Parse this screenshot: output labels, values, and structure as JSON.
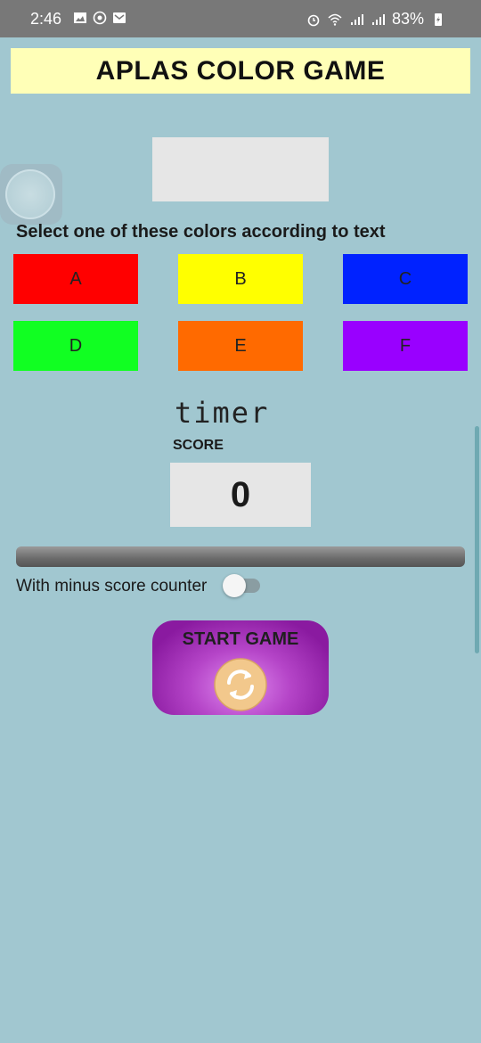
{
  "status_bar": {
    "time": "2:46",
    "battery": "83%",
    "left_icons": [
      "image-icon",
      "whatsapp-icon",
      "email-icon"
    ],
    "right_icons": [
      "alarm-icon",
      "wifi-icon",
      "signal-icon",
      "signal-icon",
      "battery-icon"
    ]
  },
  "app": {
    "title": "APLAS COLOR GAME",
    "instruction": "Select one of these colors according to text",
    "color_buttons": [
      {
        "label": "A",
        "color": "#ff0000"
      },
      {
        "label": "B",
        "color": "#ffff00"
      },
      {
        "label": "C",
        "color": "#0022ff"
      },
      {
        "label": "D",
        "color": "#11ff22"
      },
      {
        "label": "E",
        "color": "#ff6a00"
      },
      {
        "label": "F",
        "color": "#9900ff"
      }
    ],
    "timer_label": "timer",
    "score_label": "SCORE",
    "score_value": "0",
    "minus_counter_label": "With minus score counter",
    "minus_counter_enabled": false,
    "start_button_label": "START GAME"
  },
  "colors": {
    "background": "#a1c7d0",
    "title_banner": "#ffffb7",
    "start_button": "#9a24b0"
  }
}
